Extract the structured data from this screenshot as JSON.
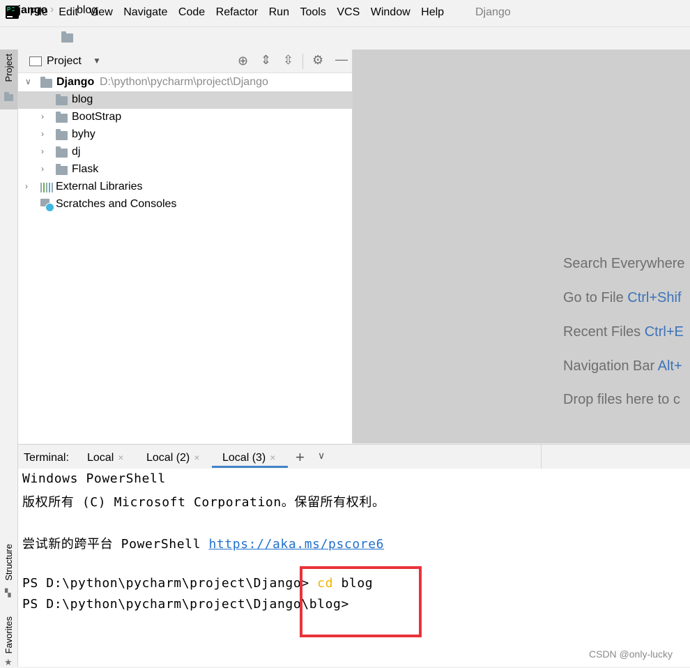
{
  "menubar": {
    "items": [
      "File",
      "Edit",
      "View",
      "Navigate",
      "Code",
      "Refactor",
      "Run",
      "Tools",
      "VCS",
      "Window",
      "Help"
    ],
    "window_title": "Django"
  },
  "breadcrumb": {
    "root": "Django",
    "folder": "blog"
  },
  "left_strip": {
    "project_tab": "Project",
    "structure_tab": "Structure",
    "favorites_tab": "Favorites"
  },
  "project_panel": {
    "view_selector": "Project",
    "root": {
      "name": "Django",
      "path": "D:\\python\\pycharm\\project\\Django"
    },
    "items": [
      {
        "label": "blog",
        "selected": true
      },
      {
        "label": "BootStrap"
      },
      {
        "label": "byhy"
      },
      {
        "label": "dj"
      },
      {
        "label": "Flask"
      }
    ],
    "external_libraries": "External Libraries",
    "scratches": "Scratches and Consoles"
  },
  "editor_hints": [
    {
      "text": "Search Everywhere",
      "key": ""
    },
    {
      "text": "Go to File ",
      "key": "Ctrl+Shif"
    },
    {
      "text": "Recent Files ",
      "key": "Ctrl+E"
    },
    {
      "text": "Navigation Bar ",
      "key": "Alt+"
    },
    {
      "text": "Drop files here to c",
      "key": ""
    }
  ],
  "terminal": {
    "label": "Terminal:",
    "tabs": [
      "Local",
      "Local (2)",
      "Local (3)"
    ],
    "active_tab": "Local (3)",
    "lines": {
      "l1": "Windows PowerShell",
      "l2": "版权所有 (C) Microsoft Corporation。保留所有权利。",
      "l3_prefix": "尝试新的跨平台 PowerShell ",
      "l3_link": "https://aka.ms/pscore6",
      "l4_prompt": "PS D:\\python\\pycharm\\project\\Django> ",
      "l4_cmd": "cd",
      "l4_arg": " blog",
      "l5": "PS D:\\python\\pycharm\\project\\Django\\blog>"
    }
  },
  "watermark": "CSDN @only-lucky",
  "colors": {
    "highlight_box": "#e8333a",
    "command": "#f0b400",
    "link": "#2370cc",
    "key_hint": "#3b73b9"
  }
}
